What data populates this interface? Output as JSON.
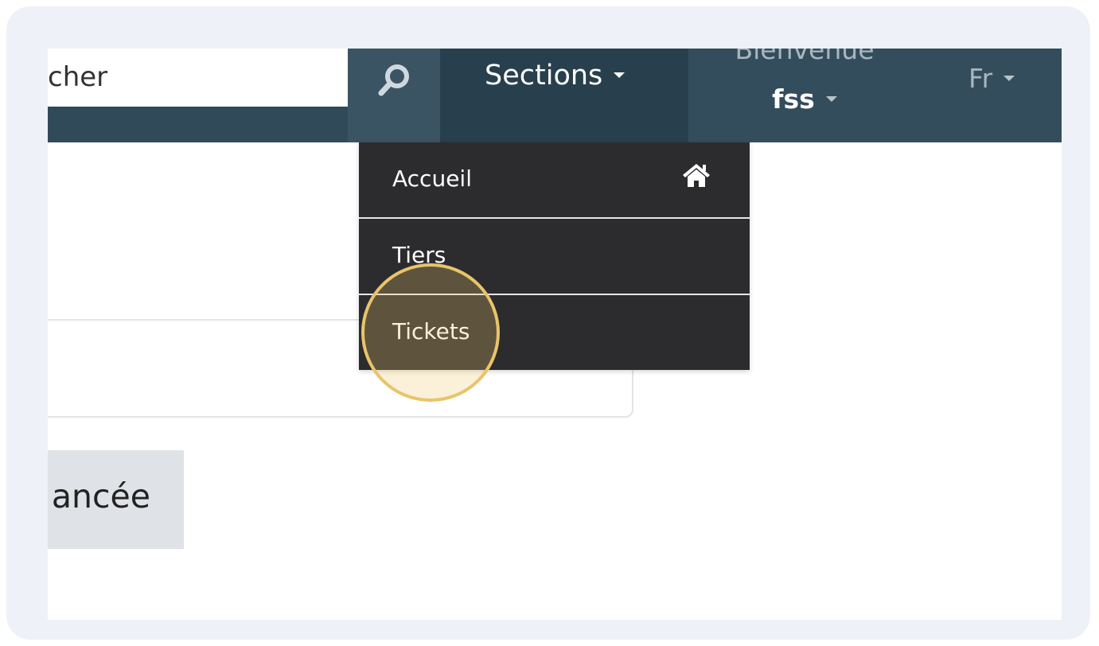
{
  "navbar": {
    "search_placeholder": "Rechercher",
    "search_value": "cher",
    "sections_label": "Sections",
    "welcome_text": "Bienvenue",
    "username": "fss",
    "language": "Fr"
  },
  "dropdown": {
    "items": [
      {
        "label": "Accueil",
        "icon": "home-icon"
      },
      {
        "label": "Tiers"
      },
      {
        "label": "Tickets"
      }
    ]
  },
  "main": {
    "advanced_search_label": "ancée"
  },
  "colors": {
    "navbar": "#304a59",
    "dropdown": "#2c2c2e",
    "highlight": "#e9c46a"
  }
}
